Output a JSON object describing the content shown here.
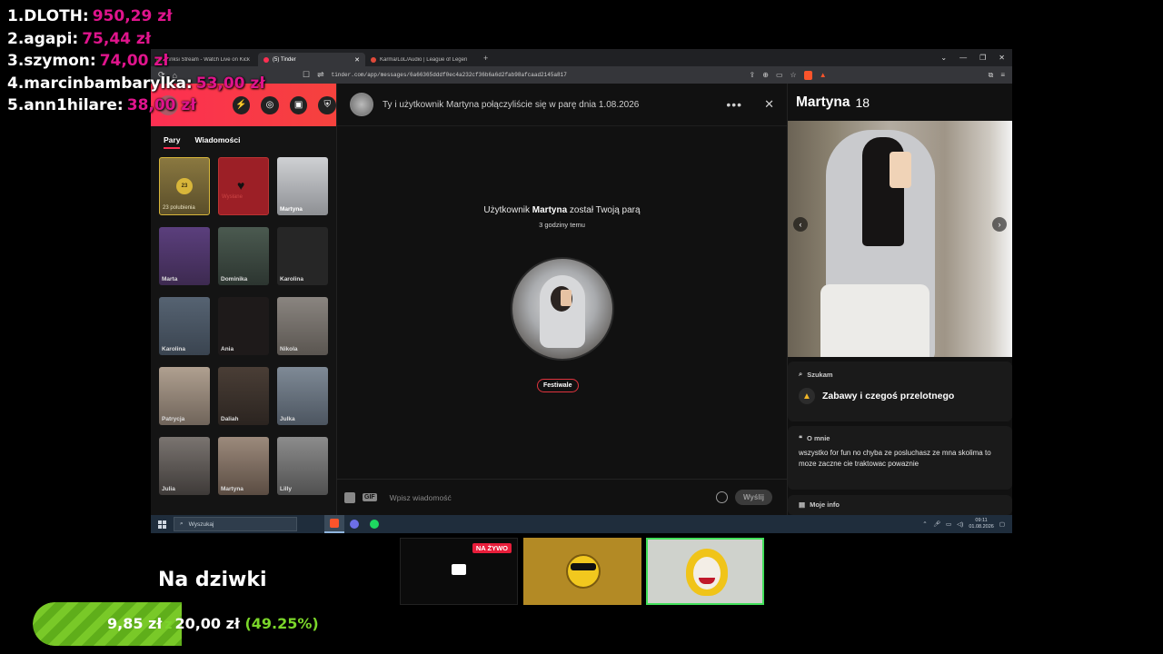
{
  "leaderboard": [
    {
      "name": "1.DLOTH:",
      "amount": "950,29 zł"
    },
    {
      "name": "2.agapi:",
      "amount": "75,44 zł"
    },
    {
      "name": "3.szymon:",
      "amount": "74,00 zł"
    },
    {
      "name": "4.marcinbambarylka:",
      "amount": "53,00 zł"
    },
    {
      "name": "5.ann1hilare:",
      "amount": "38,00 zł"
    }
  ],
  "browser": {
    "tabs": [
      {
        "label": "Kinksi Stream - Watch Live on Kick",
        "active": false
      },
      {
        "label": "(5) Tinder",
        "active": true
      },
      {
        "label": "Karma/LoL/Audio | League of Legends",
        "active": false
      }
    ],
    "url": "tinder.com/app/messages/6a66365dddf0ec4a232cf36b6a6d2fab98afcaad2145a817"
  },
  "tinder": {
    "left_tabs": [
      "Pary",
      "Wiadomości"
    ],
    "likes_count": "23",
    "likes_label": "23 polubienia",
    "platinum_label": "Wysłane",
    "matches": [
      "Martyna",
      "Marta",
      "Dominika",
      "Karolina",
      "Karolina",
      "Ania",
      "Nikola",
      "Patrycja",
      "Daliah",
      "Julka",
      "Julia",
      "Martyna",
      "Lilly"
    ],
    "chat": {
      "header": "Ty i użytkownik Martyna połączyliście się w parę dnia 1.08.2026",
      "match_prefix": "Użytkownik",
      "match_name": "Martyna",
      "match_suffix": "został Twoją parą",
      "match_time": "3 godziny temu",
      "interest_chip": "Festiwale",
      "input_placeholder": "Wpisz wiadomość",
      "send_label": "Wyślij",
      "gif_label": "GIF"
    },
    "profile": {
      "name": "Martyna",
      "age": "18",
      "looking_for_title": "Szukam",
      "looking_for_value": "Zabawy i czegoś przelotnego",
      "about_title": "O mnie",
      "about_text": "wszystko for fun no chyba ze posluchasz ze mna skolima to moze zaczne cie traktowac powaznie",
      "info_title": "Moje info"
    }
  },
  "taskbar": {
    "search_placeholder": "Wyszukaj",
    "time": "09:11",
    "date": "01.08.2026"
  },
  "overlay": {
    "live_badge": "NA ŻYWO",
    "goal_title": "Na dziwki",
    "goal_current": "9,85 zł",
    "goal_sep": "z",
    "goal_target": "20,00 zł",
    "goal_percent_label": "(49.25%)",
    "goal_fraction": 0.4925
  },
  "colors": {
    "tinder_red": "#fd2f52",
    "leaderboard_amount": "#e0148c",
    "goal_green": "#7bd62a"
  }
}
